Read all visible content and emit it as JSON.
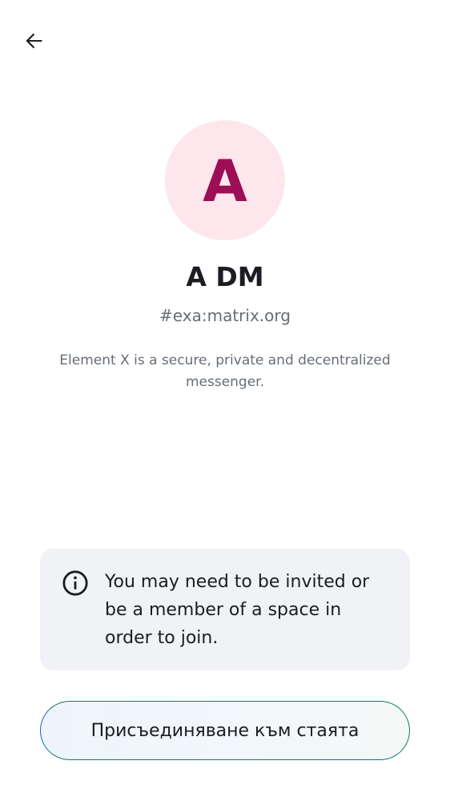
{
  "header": {
    "back_icon": "arrow-left-icon"
  },
  "room": {
    "avatar_letter": "A",
    "avatar_bg": "#fde6ec",
    "avatar_fg": "#9c0e55",
    "name": "A DM",
    "alias": "#exa:matrix.org",
    "topic": "Element X is a secure, private and decentralized messenger."
  },
  "notice": {
    "icon": "info-icon",
    "text": "You may need to be invited or be a member of a space in order to join."
  },
  "actions": {
    "join_label": "Присъединяване към стаята"
  }
}
